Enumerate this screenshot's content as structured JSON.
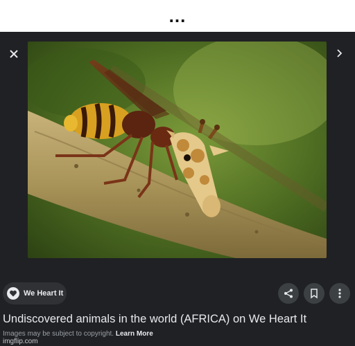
{
  "caption": {
    "text": "..."
  },
  "viewer": {
    "close_icon": "close-icon",
    "prev_icon": "chevron-left-icon",
    "next_icon": "chevron-right-icon",
    "image_description_icon": "photo"
  },
  "source": {
    "name": "We Heart It",
    "favicon_icon": "weheartit-logo-icon"
  },
  "actions": {
    "share_icon": "share-icon",
    "save_icon": "bookmark-icon",
    "more_icon": "more-vertical-icon"
  },
  "result": {
    "title": "Undiscovered animals in the world (AFRICA) on We Heart It",
    "copyright_text": "Images may be subject to copyright.",
    "learn_more": "Learn More"
  },
  "watermark": {
    "text": "imgflip.com"
  },
  "colors": {
    "viewer_bg": "#202124",
    "chip_bg": "#303134",
    "button_bg": "#3c4043",
    "text_primary": "#e8eaed",
    "text_secondary": "#9aa0a6"
  }
}
